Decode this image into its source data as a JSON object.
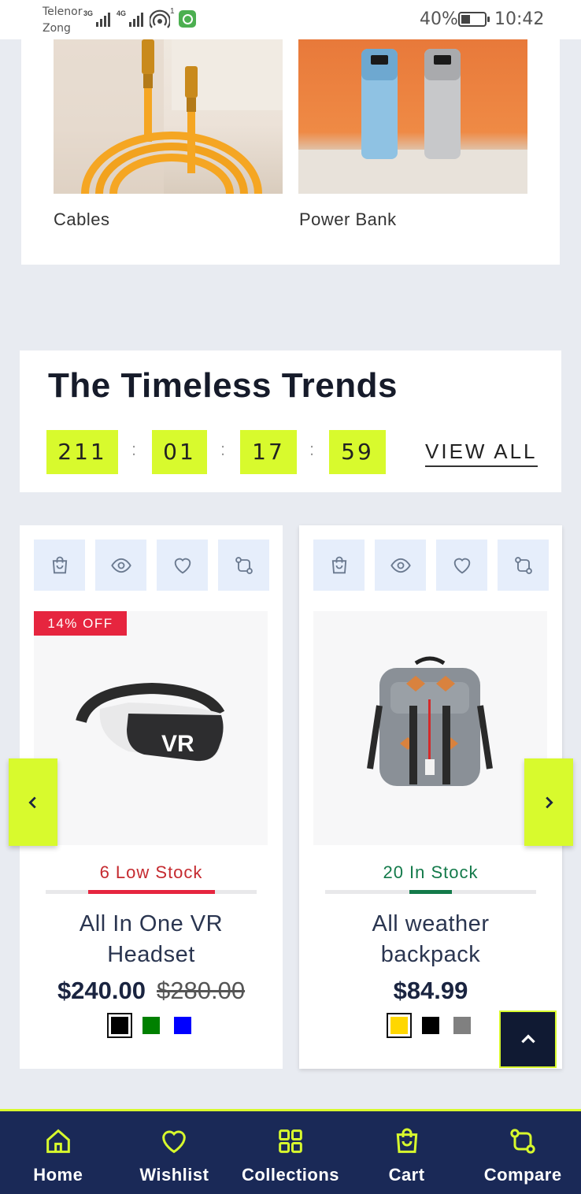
{
  "status_bar": {
    "carrier1": "Telenor",
    "carrier2": "Zong",
    "signal1_label": "3G",
    "signal2_label": "4G",
    "hotspot_count": "1",
    "battery_percent": "40%",
    "battery_level": 0.4,
    "time": "10:42"
  },
  "categories": [
    {
      "label": "Cables",
      "icon": "cable-image"
    },
    {
      "label": "Power Bank",
      "icon": "power-bank-image"
    }
  ],
  "trends": {
    "title": "The Timeless Trends",
    "countdown": {
      "days": "211",
      "hours": "01",
      "minutes": "17",
      "seconds": "59",
      "separator": ":"
    },
    "view_all": "VIEW ALL"
  },
  "products": [
    {
      "badge": "14% OFF",
      "stock_text": "6 Low Stock",
      "stock_level": 0.6,
      "name_line1": "All In One VR",
      "name_line2": "Headset",
      "price": "$240.00",
      "old_price": "$280.00",
      "swatches": [
        "#000000",
        "#008000",
        "#0000ff"
      ],
      "selected_swatch": 0
    },
    {
      "badge": "",
      "stock_text": "20 In Stock",
      "stock_level": 0.2,
      "name_line1": "All weather",
      "name_line2": "backpack",
      "price": "$84.99",
      "old_price": "",
      "swatches": [
        "#ffd700",
        "#000000",
        "#808080"
      ],
      "selected_swatch": 0
    }
  ],
  "card_actions": [
    "cart-icon",
    "eye-icon",
    "heart-icon",
    "compare-icon"
  ],
  "bottom_nav": [
    {
      "label": "Home",
      "icon": "home-icon"
    },
    {
      "label": "Wishlist",
      "icon": "heart-icon"
    },
    {
      "label": "Collections",
      "icon": "grid-icon"
    },
    {
      "label": "Cart",
      "icon": "bag-icon"
    },
    {
      "label": "Compare",
      "icon": "compare-icon"
    }
  ],
  "colors": {
    "accent": "#d8fa2d",
    "navy": "#1a2957",
    "sale_red": "#e6253f",
    "low_stock": "#c52a2f",
    "in_stock": "#137a4a"
  }
}
